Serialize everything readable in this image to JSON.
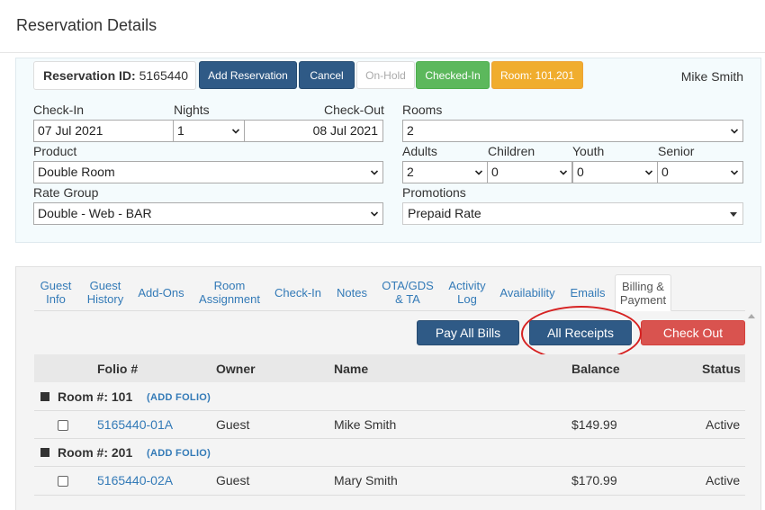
{
  "modal": {
    "title": "Reservation Details"
  },
  "reservation": {
    "id_label": "Reservation ID:",
    "id_value": "5165440",
    "guest_name": "Mike Smith",
    "buttons": {
      "add_reservation": "Add Reservation",
      "cancel": "Cancel",
      "on_hold": "On-Hold",
      "checked_in": "Checked-In",
      "room": "Room: 101,201"
    }
  },
  "form": {
    "check_in": {
      "label": "Check-In",
      "value": "07 Jul 2021"
    },
    "nights": {
      "label": "Nights",
      "value": "1"
    },
    "check_out": {
      "label": "Check-Out",
      "value": "08 Jul 2021"
    },
    "rooms": {
      "label": "Rooms",
      "value": "2"
    },
    "product": {
      "label": "Product",
      "value": "Double Room"
    },
    "adults": {
      "label": "Adults",
      "value": "2"
    },
    "children": {
      "label": "Children",
      "value": "0"
    },
    "youth": {
      "label": "Youth",
      "value": "0"
    },
    "senior": {
      "label": "Senior",
      "value": "0"
    },
    "rate_group": {
      "label": "Rate Group",
      "value": "Double - Web - BAR"
    },
    "promotions": {
      "label": "Promotions",
      "value": "Prepaid Rate"
    }
  },
  "tabs": [
    {
      "l1": "Guest",
      "l2": "Info"
    },
    {
      "l1": "Guest",
      "l2": "History"
    },
    {
      "l1": "Add-Ons",
      "l2": ""
    },
    {
      "l1": "Room",
      "l2": "Assignment"
    },
    {
      "l1": "Check-In",
      "l2": ""
    },
    {
      "l1": "Notes",
      "l2": ""
    },
    {
      "l1": "OTA/GDS",
      "l2": "& TA"
    },
    {
      "l1": "Activity",
      "l2": "Log"
    },
    {
      "l1": "Availability",
      "l2": ""
    },
    {
      "l1": "Emails",
      "l2": ""
    },
    {
      "l1": "Billing &",
      "l2": "Payment"
    }
  ],
  "billing": {
    "pay_all_bills": "Pay All Bills",
    "all_receipts": "All Receipts",
    "check_out": "Check Out",
    "columns": {
      "folio": "Folio #",
      "owner": "Owner",
      "name": "Name",
      "balance": "Balance",
      "status": "Status"
    },
    "add_folio": "(ADD FOLIO)",
    "rooms": [
      {
        "label": "Room #: 101",
        "folio": "5165440-01A",
        "owner": "Guest",
        "name": "Mike Smith",
        "balance": "$149.99",
        "status": "Active"
      },
      {
        "label": "Room #: 201",
        "folio": "5165440-02A",
        "owner": "Guest",
        "name": "Mary Smith",
        "balance": "$170.99",
        "status": "Active"
      }
    ]
  },
  "colors": {
    "primary": "#2f5a86",
    "success": "#5cb85c",
    "warning": "#f0ad2e",
    "danger": "#d9534f",
    "link": "#337ab7",
    "highlight": "#d62222"
  }
}
